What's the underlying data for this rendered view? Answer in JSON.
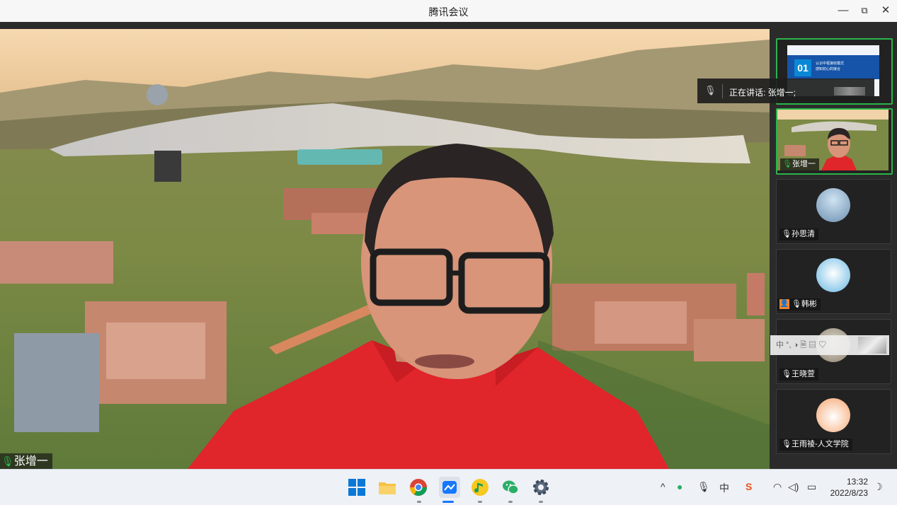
{
  "app": {
    "title": "腾讯会议"
  },
  "window_controls": {
    "minimize": "—",
    "maximize": "⧉",
    "close": "✕"
  },
  "main_video": {
    "participant_name": "张增一"
  },
  "speaking": {
    "label": "正在讲话: 张增一;"
  },
  "share_slide": {
    "number": "01",
    "line1": "认识中枢接收模式",
    "line2": "感知初心的接合"
  },
  "participants": [
    {
      "name": "张增一",
      "mic": "on"
    },
    {
      "name": "孙思清",
      "mic": "muted"
    },
    {
      "name": "韩彬",
      "mic": "muted"
    },
    {
      "name": "王晓萱",
      "mic": "muted"
    },
    {
      "name": "王雨祾-人文学院",
      "mic": "muted"
    }
  ],
  "ime_toolbar": {
    "items": "中 °, ◑ 🗎 ▤ ♡"
  },
  "taskbar": {
    "tray": {
      "chevron": "^",
      "ime": "中",
      "clock_time": "13:32",
      "clock_date": "2022/8/23"
    }
  },
  "colors": {
    "accent_green": "#2bb54a",
    "shirt_red": "#e0252b"
  }
}
